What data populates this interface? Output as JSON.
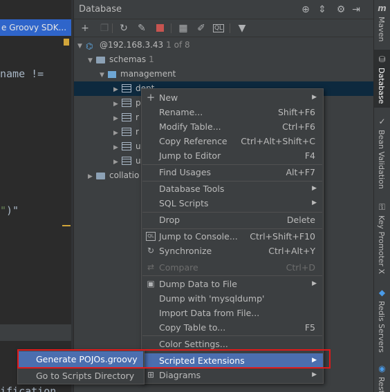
{
  "editor": {
    "tab_label": "e Groovy SDK...",
    "code_line_1": "name !=",
    "code_line_2a": "\"",
    "code_line_2b": ")\"",
    "code_line_3": "ification"
  },
  "panel": {
    "title": "Database",
    "header_icons": [
      "target-icon",
      "collapse-icon",
      "gear-icon",
      "hide-icon"
    ]
  },
  "toolbar": {
    "buttons": [
      "add-icon",
      "copy-icon",
      "refresh-icon",
      "properties-icon",
      "stop-icon",
      "table-icon",
      "edit-icon",
      "console-icon",
      "filter-icon"
    ]
  },
  "tree": {
    "host": "@192.168.3.43",
    "host_count": "1 of 8",
    "schemas": "schemas",
    "schemas_count": "1",
    "schema_name": "management",
    "tables": [
      "dept",
      "p",
      "r",
      "r",
      "u",
      "u"
    ],
    "collations": "collatio"
  },
  "tool_strip": {
    "maven": "Maven",
    "database": "Database",
    "bean_validation": "Bean Validation",
    "key_promoter": "Key Promoter X",
    "redis": "Redis Servers",
    "rest": "RestS"
  },
  "menu": {
    "items": [
      {
        "label": "New",
        "shortcut": "",
        "submenu": true
      },
      {
        "label": "Rename...",
        "shortcut": "Shift+F6"
      },
      {
        "label": "Modify Table...",
        "shortcut": "Ctrl+F6"
      },
      {
        "label": "Copy Reference",
        "shortcut": "Ctrl+Alt+Shift+C"
      },
      {
        "label": "Jump to Editor",
        "shortcut": "F4"
      },
      {
        "label": "Find Usages",
        "shortcut": "Alt+F7"
      },
      {
        "label": "Database Tools",
        "shortcut": "",
        "submenu": true
      },
      {
        "label": "SQL Scripts",
        "shortcut": "",
        "submenu": true
      },
      {
        "label": "Drop",
        "shortcut": "Delete"
      },
      {
        "label": "Jump to Console...",
        "shortcut": "Ctrl+Shift+F10"
      },
      {
        "label": "Synchronize",
        "shortcut": "Ctrl+Alt+Y"
      },
      {
        "label": "Compare",
        "shortcut": "Ctrl+D"
      },
      {
        "label": "Dump Data to File",
        "shortcut": "",
        "submenu": true
      },
      {
        "label": "Dump with 'mysqldump'",
        "shortcut": ""
      },
      {
        "label": "Import Data from File...",
        "shortcut": ""
      },
      {
        "label": "Copy Table to...",
        "shortcut": "F5"
      },
      {
        "label": "Color Settings...",
        "shortcut": ""
      },
      {
        "label": "Scripted Extensions",
        "shortcut": "",
        "submenu": true
      },
      {
        "label": "Diagrams",
        "shortcut": "",
        "submenu": true
      }
    ]
  },
  "submenu": {
    "items": [
      "Generate POJOs.groovy",
      "Go to Scripts Directory"
    ]
  }
}
